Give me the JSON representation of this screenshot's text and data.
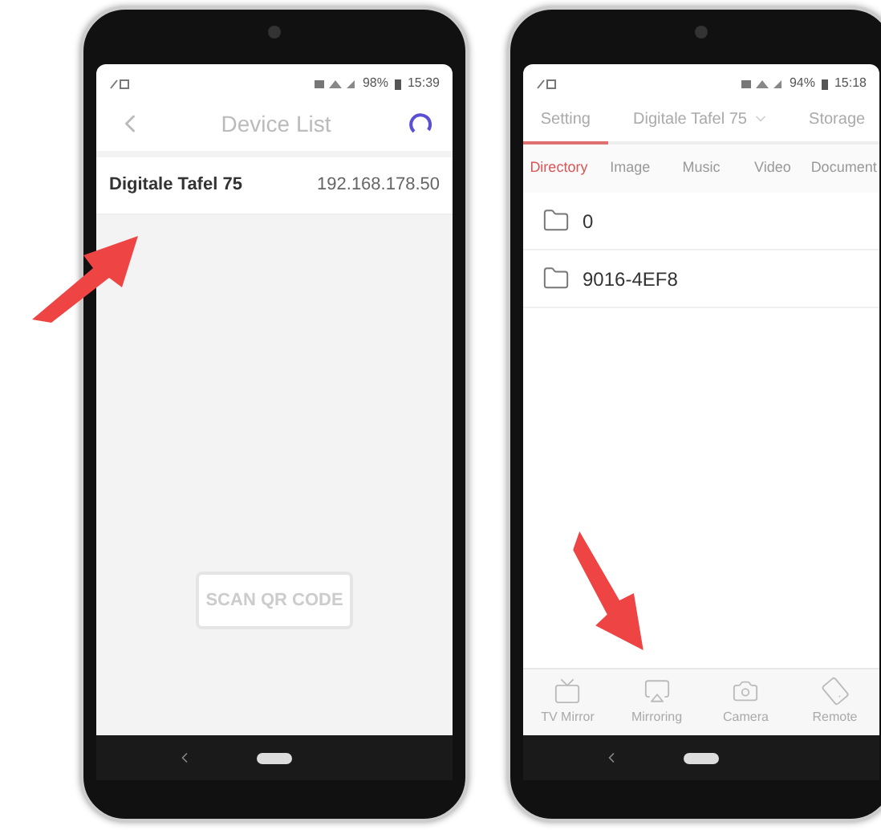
{
  "left_phone": {
    "status_bar": {
      "battery": "98%",
      "time": "15:39"
    },
    "header": {
      "title": "Device List"
    },
    "devices": [
      {
        "name": "Digitale Tafel 75",
        "ip": "192.168.178.50"
      }
    ],
    "scan_button": "SCAN QR CODE"
  },
  "right_phone": {
    "status_bar": {
      "battery": "94%",
      "time": "15:18"
    },
    "top_tabs": [
      {
        "label": "Setting",
        "kind": "tab",
        "selected": true
      },
      {
        "label": "Digitale Tafel 75",
        "kind": "dropdown",
        "selected": false
      },
      {
        "label": "Storage",
        "kind": "tab",
        "selected": false
      }
    ],
    "sub_tabs": [
      {
        "label": "Directory",
        "selected": true
      },
      {
        "label": "Image",
        "selected": false
      },
      {
        "label": "Music",
        "selected": false
      },
      {
        "label": "Video",
        "selected": false
      },
      {
        "label": "Document",
        "selected": false
      }
    ],
    "folders": [
      {
        "name": "0"
      },
      {
        "name": "9016-4EF8"
      }
    ],
    "bottom_bar": [
      {
        "label": "TV Mirror",
        "kind": "tv"
      },
      {
        "label": "Mirroring",
        "kind": "cast"
      },
      {
        "label": "Camera",
        "kind": "camera"
      },
      {
        "label": "Remote",
        "kind": "remote"
      }
    ]
  }
}
